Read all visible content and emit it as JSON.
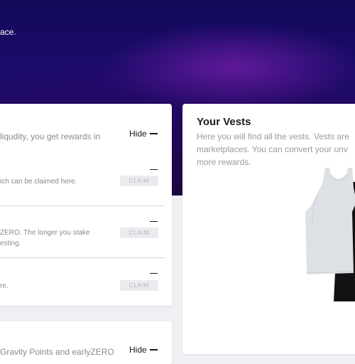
{
  "hero": {
    "subtitle": "ace."
  },
  "rewards_card": {
    "intro_line1": "liqudity, you get rewards in",
    "hide_label": "Hide",
    "rows": [
      {
        "text_line1": "ich can be claimed here.",
        "text_line2": "",
        "value": "—",
        "claim_label": "CLAIM"
      },
      {
        "text_line1": "ZERO. The longer you stake",
        "text_line2": "esting.",
        "value": "—",
        "claim_label": "CLAIM"
      },
      {
        "text_line1": "re.",
        "text_line2": "",
        "value": "—",
        "claim_label": "CLAIM"
      }
    ]
  },
  "vests_card": {
    "title": "Your Vests",
    "desc_line1": "Here you will find all the vests. Vests are",
    "desc_line2": "marketplaces. You can convert your unv",
    "desc_line3": "more rewards.",
    "image": "vest-garments-image"
  },
  "bottom_card": {
    "text": "Gravity Points and earlyZERO",
    "hide_label": "Hide"
  }
}
